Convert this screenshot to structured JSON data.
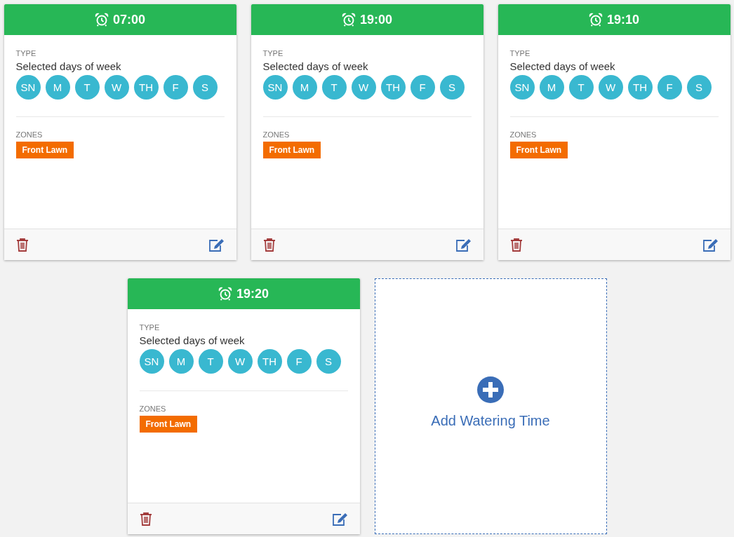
{
  "schedules": [
    {
      "time": "07:00",
      "type_label": "TYPE",
      "type_value": "Selected days of week",
      "days": [
        {
          "label": "SN",
          "selected": true
        },
        {
          "label": "M",
          "selected": true
        },
        {
          "label": "T",
          "selected": true
        },
        {
          "label": "W",
          "selected": true
        },
        {
          "label": "TH",
          "selected": true
        },
        {
          "label": "F",
          "selected": true
        },
        {
          "label": "S",
          "selected": true
        }
      ],
      "zones_label": "ZONES",
      "zones": [
        "Front Lawn"
      ]
    },
    {
      "time": "19:00",
      "type_label": "TYPE",
      "type_value": "Selected days of week",
      "days": [
        {
          "label": "SN",
          "selected": true
        },
        {
          "label": "M",
          "selected": true
        },
        {
          "label": "T",
          "selected": true
        },
        {
          "label": "W",
          "selected": true
        },
        {
          "label": "TH",
          "selected": true
        },
        {
          "label": "F",
          "selected": true
        },
        {
          "label": "S",
          "selected": true
        }
      ],
      "zones_label": "ZONES",
      "zones": [
        "Front Lawn"
      ]
    },
    {
      "time": "19:10",
      "type_label": "TYPE",
      "type_value": "Selected days of week",
      "days": [
        {
          "label": "SN",
          "selected": true
        },
        {
          "label": "M",
          "selected": true
        },
        {
          "label": "T",
          "selected": true
        },
        {
          "label": "W",
          "selected": true
        },
        {
          "label": "TH",
          "selected": true
        },
        {
          "label": "F",
          "selected": true
        },
        {
          "label": "S",
          "selected": true
        }
      ],
      "zones_label": "ZONES",
      "zones": [
        "Front Lawn"
      ]
    },
    {
      "time": "19:20",
      "type_label": "TYPE",
      "type_value": "Selected days of week",
      "days": [
        {
          "label": "SN",
          "selected": true
        },
        {
          "label": "M",
          "selected": true
        },
        {
          "label": "T",
          "selected": true
        },
        {
          "label": "W",
          "selected": true
        },
        {
          "label": "TH",
          "selected": true
        },
        {
          "label": "F",
          "selected": true
        },
        {
          "label": "S",
          "selected": true
        }
      ],
      "zones_label": "ZONES",
      "zones": [
        "Front Lawn"
      ]
    }
  ],
  "add_card": {
    "label": "Add Watering Time"
  }
}
